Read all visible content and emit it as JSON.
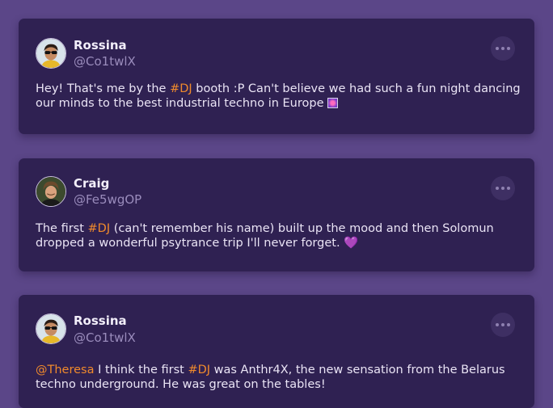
{
  "posts": [
    {
      "name": "Rossina",
      "handle": "@Co1twlX",
      "text_parts": [
        "Hey! That's me by the ",
        "#DJ",
        " booth :P Can't believe we had such a fun night dancing our minds to the best industrial techno in Europe "
      ],
      "emoji": "sparkle-image-emoji"
    },
    {
      "name": "Craig",
      "handle": "@Fe5wgOP",
      "text_parts": [
        "The first ",
        "#DJ",
        " (can't remember his name) built up the mood and then Solomun dropped a wonderful psytrance trip I'll never forget. "
      ],
      "emoji_char": "💜"
    },
    {
      "name": "Rossina",
      "handle": "@Co1twlX",
      "text_parts": [
        "@Theresa",
        " I think the first ",
        "#DJ",
        " was Anthr4X, the new sensation from the Belarus techno underground. He was great on the tables!"
      ]
    }
  ],
  "colors": {
    "background": "#5b4688",
    "card": "#2f2152",
    "hashtag": "#f08a2c",
    "handle": "#9a8cbc"
  }
}
